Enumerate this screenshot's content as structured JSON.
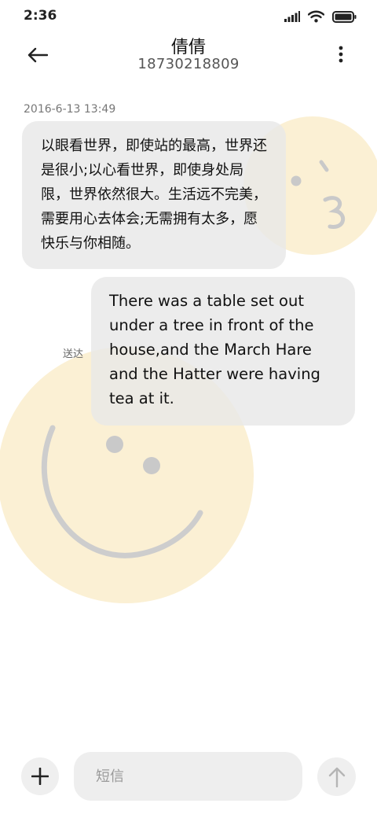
{
  "status_bar": {
    "time": "2:36",
    "icons": [
      "signal-icon",
      "wifi-icon",
      "battery-icon"
    ]
  },
  "header": {
    "contact_name": "倩倩",
    "contact_number": "18730218809",
    "back_icon": "back-arrow-icon",
    "menu_icon": "more-vertical-icon"
  },
  "conversation": {
    "timestamp": "2016-6-13 13:49",
    "incoming_message": "以眼看世界，即使站的最高，世界还是很小;以心看世界，即使身处局限，世界依然很大。生活远不完美，需要用心去体会;无需拥有太多，愿快乐与你相随。",
    "outgoing_message": "There was a table set out under a tree in front of the house,and the March Hare and the Hatter were having tea at it.",
    "delivery_status": "送达"
  },
  "composer": {
    "placeholder": "短信",
    "value": "",
    "add_icon": "plus-icon",
    "send_icon": "send-arrow-icon"
  },
  "colors": {
    "bubble_background": "#e8e8e8",
    "decor_yellow": "#fbf0d4",
    "decor_gray": "#c9c9c9",
    "button_background": "#efefef"
  }
}
